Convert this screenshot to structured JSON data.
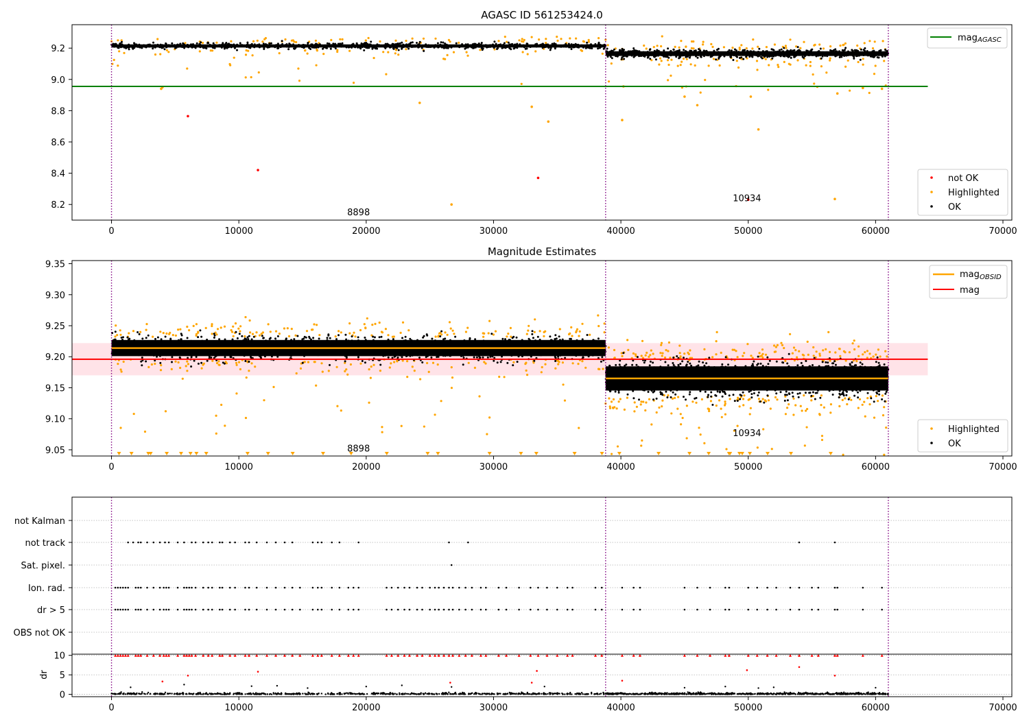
{
  "colors": {
    "ok": "#000000",
    "highlighted": "#ffa500",
    "not_ok": "#ff0000",
    "agasc_line": "#008000",
    "mag_line": "#ff0000",
    "obsid_line": "#ffa500",
    "band_fill": "#ffc0cb",
    "obsid_boundary": "#800080"
  },
  "chart_data": [
    {
      "type": "scatter",
      "title": "AGASC ID 561253424.0",
      "xlabel": "",
      "ylabel": "",
      "xlim": [
        -3100,
        70700
      ],
      "ylim": [
        8.1,
        9.35
      ],
      "x_ticks": [
        0,
        10000,
        20000,
        30000,
        40000,
        50000,
        60000,
        70000
      ],
      "y_ticks": [
        8.2,
        8.4,
        8.6,
        8.8,
        9.0,
        9.2
      ],
      "y_tick_labels": [
        "8.2",
        "8.4",
        "8.6",
        "8.8",
        "9.0",
        "9.2"
      ],
      "grid": false,
      "legend_placement": "top-right / bottom-right",
      "obsid_boundaries": [
        0,
        38800,
        61000
      ],
      "obsid_labels": [
        {
          "text": "8898",
          "x": 19400,
          "y": 8.13
        },
        {
          "text": "10934",
          "x": 49900,
          "y": 8.22
        }
      ],
      "hlines": [
        {
          "name": "mag_AGASC",
          "y": 8.955,
          "x_range": [
            -3100,
            64100
          ]
        }
      ],
      "segments": [
        {
          "x_range": [
            0,
            38800
          ],
          "mean": 9.214,
          "spread": 0.02
        },
        {
          "x_range": [
            38800,
            61000
          ],
          "mean": 9.165,
          "spread": 0.03
        }
      ],
      "series": [
        {
          "name": "not OK",
          "points": [
            [
              6000,
              8.765
            ],
            [
              11500,
              8.42
            ],
            [
              33500,
              8.37
            ],
            [
              50000,
              8.23
            ]
          ]
        },
        {
          "name": "Highlighted",
          "points": [
            [
              3900,
              8.94
            ],
            [
              4000,
              8.95
            ],
            [
              24200,
              8.85
            ],
            [
              33000,
              8.825
            ],
            [
              34300,
              8.73
            ],
            [
              40100,
              8.74
            ],
            [
              45000,
              8.89
            ],
            [
              46000,
              8.835
            ],
            [
              50200,
              8.89
            ],
            [
              50800,
              8.68
            ],
            [
              26700,
              8.2
            ],
            [
              56800,
              8.235
            ],
            [
              57000,
              8.91
            ],
            [
              59000,
              8.945
            ],
            [
              60500,
              8.94
            ],
            [
              40200,
              8.955
            ]
          ]
        },
        {
          "name": "OK",
          "points": []
        }
      ],
      "legend": [
        {
          "label": "mag",
          "sub": "AGASC",
          "style": "line",
          "color_key": "agasc_line"
        },
        {
          "label": "not OK",
          "style": "dot",
          "color_key": "not_ok"
        },
        {
          "label": "Highlighted",
          "style": "dot",
          "color_key": "highlighted"
        },
        {
          "label": "OK",
          "style": "dot",
          "color_key": "ok"
        }
      ]
    },
    {
      "type": "scatter",
      "title": "Magnitude Estimates",
      "xlabel": "",
      "ylabel": "",
      "xlim": [
        -3100,
        70700
      ],
      "ylim": [
        9.04,
        9.355
      ],
      "x_ticks": [
        0,
        10000,
        20000,
        30000,
        40000,
        50000,
        60000,
        70000
      ],
      "y_ticks": [
        9.05,
        9.1,
        9.15,
        9.2,
        9.25,
        9.3,
        9.35
      ],
      "y_tick_labels": [
        "9.05",
        "9.10",
        "9.15",
        "9.20",
        "9.25",
        "9.30",
        "9.35"
      ],
      "grid": false,
      "obsid_boundaries": [
        0,
        38800,
        61000
      ],
      "obsid_labels": [
        {
          "text": "8898",
          "x": 19400,
          "y": 9.047
        },
        {
          "text": "10934",
          "x": 49900,
          "y": 9.072
        }
      ],
      "hlines": [
        {
          "name": "mag",
          "y": 9.196,
          "x_range": [
            -3100,
            64100
          ]
        }
      ],
      "band": {
        "y_range": [
          9.17,
          9.222
        ],
        "x_range": [
          -3100,
          64100
        ]
      },
      "segments": [
        {
          "x_range": [
            0,
            38800
          ],
          "mean": 9.214,
          "spread": 0.02
        },
        {
          "x_range": [
            38800,
            61000
          ],
          "mean": 9.165,
          "spread": 0.03
        }
      ],
      "legend": [
        {
          "label": "mag",
          "sub": "OBSID",
          "style": "line",
          "color_key": "obsid_line"
        },
        {
          "label": "mag",
          "style": "line",
          "color_key": "mag_line"
        },
        {
          "label": "Highlighted",
          "style": "dot",
          "color_key": "highlighted"
        },
        {
          "label": "OK",
          "style": "dot",
          "color_key": "ok"
        }
      ]
    },
    {
      "type": "scatter",
      "title": "",
      "xlabel": "",
      "ylabel": "",
      "categories": [
        "not Kalman",
        "not track",
        "Sat. pixel.",
        "Ion. rad.",
        "dr > 5",
        "OBS not OK"
      ],
      "xlim": [
        -3100,
        70700
      ],
      "obsid_boundaries": [
        0,
        38800,
        61000
      ],
      "flags": {
        "not track": [
          1300,
          1700,
          2100,
          2300,
          2800,
          3300,
          3800,
          4200,
          4500,
          5200,
          5700,
          6300,
          6600,
          7200,
          7600,
          7900,
          8500,
          8700,
          9300,
          9700,
          10500,
          10800,
          11400,
          12200,
          12900,
          13600,
          14200,
          15800,
          16200,
          16500,
          17300,
          17900,
          19400,
          26500,
          28000,
          54000,
          56800
        ],
        "Sat. pixel.": [
          26700
        ],
        "Ion. rad.": [
          300,
          500,
          700,
          900,
          1100,
          1300,
          1900,
          2100,
          2300,
          2800,
          3300,
          3800,
          4100,
          4300,
          4500,
          5200,
          5700,
          5900,
          6100,
          6300,
          6600,
          7200,
          7600,
          7900,
          8500,
          8700,
          9300,
          9700,
          10500,
          10800,
          11400,
          12200,
          12900,
          13600,
          14200,
          14800,
          15800,
          16200,
          16500,
          17300,
          17900,
          18600,
          19000,
          19400,
          21600,
          22000,
          22500,
          23000,
          23400,
          24000,
          24400,
          25000,
          25400,
          25700,
          26100,
          26500,
          26800,
          27300,
          27800,
          28300,
          29000,
          29400,
          30400,
          31000,
          32000,
          32900,
          33500,
          34200,
          35000,
          35800,
          36200,
          38000,
          38500,
          40100,
          41000,
          41500,
          45000,
          46000,
          47000,
          48200,
          48500,
          50000,
          50700,
          51500,
          52200,
          53300,
          54000,
          55000,
          55500,
          56800,
          57000,
          59000,
          60500
        ],
        "dr > 5": [
          300,
          500,
          700,
          900,
          1100,
          1300,
          1900,
          2100,
          2300,
          2800,
          3300,
          3800,
          4100,
          4300,
          4500,
          5200,
          5700,
          5900,
          6100,
          6300,
          6600,
          7200,
          7600,
          7900,
          8500,
          8700,
          9300,
          9700,
          10500,
          10800,
          11400,
          12200,
          12900,
          13600,
          14200,
          14800,
          15800,
          16200,
          16500,
          17300,
          17900,
          18600,
          19000,
          19400,
          21600,
          22000,
          22500,
          23000,
          23400,
          24000,
          24400,
          25000,
          25400,
          25700,
          26100,
          26500,
          26800,
          27300,
          27800,
          28300,
          29000,
          29400,
          30400,
          31000,
          32000,
          32900,
          33500,
          34200,
          35000,
          35800,
          36200,
          38000,
          38500,
          40100,
          41000,
          41500,
          45000,
          46000,
          47000,
          48200,
          48500,
          50000,
          50700,
          51500,
          52200,
          53300,
          54000,
          55000,
          55500,
          56800,
          57000,
          59000,
          60500
        ]
      }
    },
    {
      "type": "scatter",
      "title": "",
      "xlabel": "",
      "ylabel": "dr",
      "xlim": [
        -3100,
        70700
      ],
      "ylim": [
        -0.6,
        10.3
      ],
      "x_ticks": [
        0,
        10000,
        20000,
        30000,
        40000,
        50000,
        60000,
        70000
      ],
      "y_ticks": [
        0,
        5,
        10
      ],
      "y_tick_labels": [
        "0",
        "5",
        "10"
      ],
      "obsid_boundaries": [
        0,
        38800,
        61000
      ],
      "outliers_ok": [
        [
          1500,
          1.8
        ],
        [
          11000,
          2.1
        ],
        [
          13000,
          2.2
        ],
        [
          15400,
          1.6
        ],
        [
          22800,
          2.3
        ],
        [
          26700,
          1.9
        ],
        [
          34000,
          2.0
        ],
        [
          45000,
          1.7
        ],
        [
          48200,
          2.0
        ],
        [
          50800,
          1.6
        ],
        [
          52000,
          1.8
        ],
        [
          60000,
          1.7
        ],
        [
          5700,
          2.5
        ],
        [
          20000,
          2.0
        ]
      ],
      "outliers_red": [
        [
          4000,
          3.3
        ],
        [
          6000,
          4.8
        ],
        [
          11500,
          5.8
        ],
        [
          26600,
          3.0
        ],
        [
          33000,
          3.0
        ],
        [
          33400,
          6.0
        ],
        [
          40100,
          3.5
        ],
        [
          49900,
          6.2
        ],
        [
          54000,
          7.0
        ],
        [
          56800,
          4.8
        ]
      ]
    }
  ]
}
